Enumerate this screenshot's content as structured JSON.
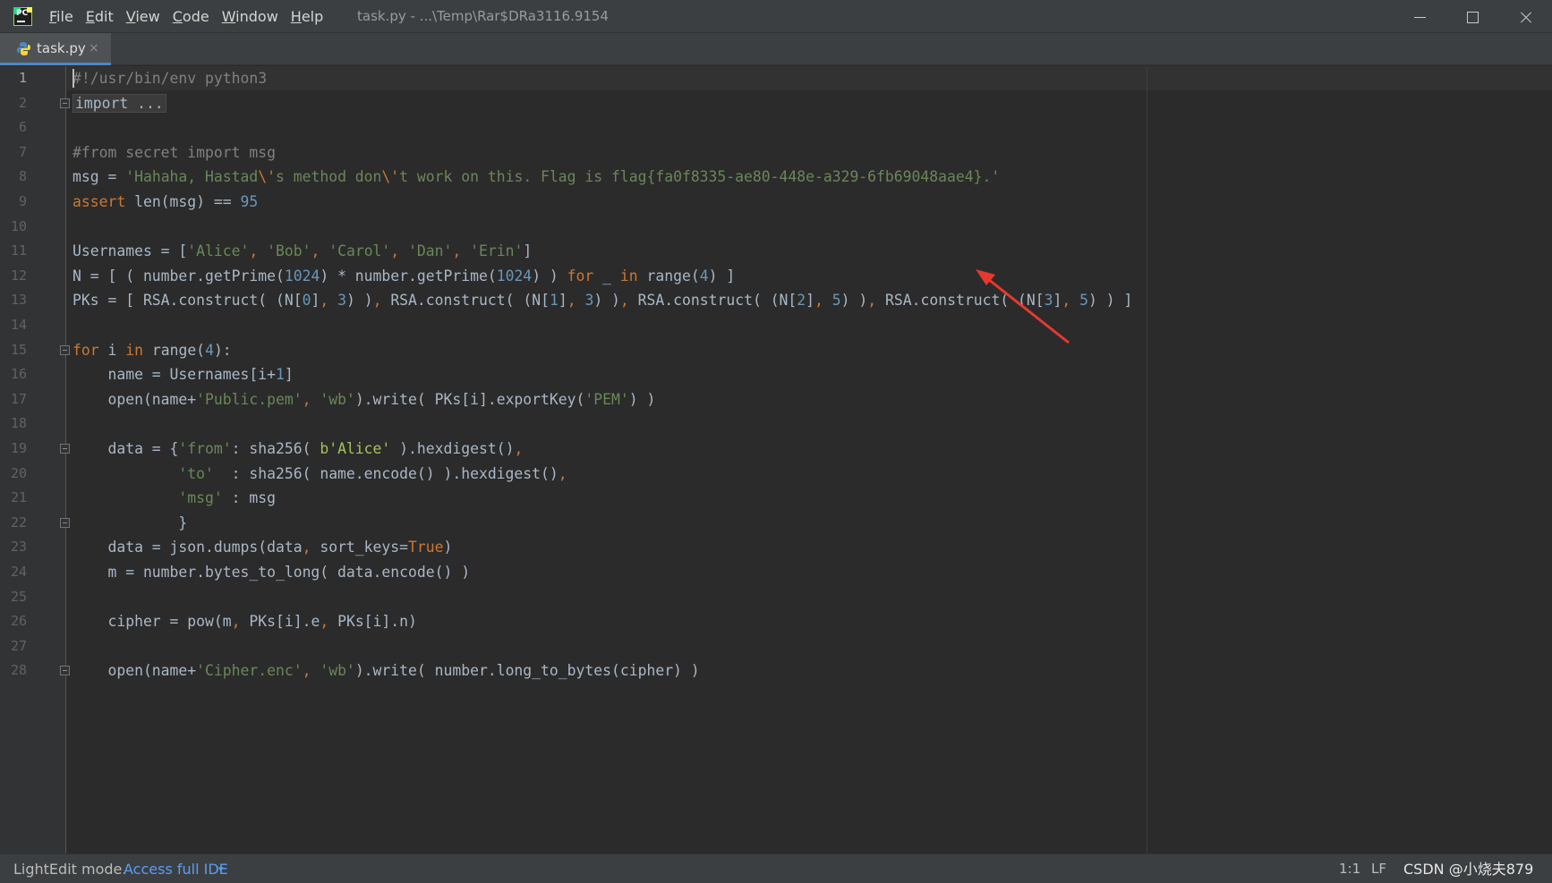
{
  "titlebar": {
    "menu": [
      {
        "label": "File",
        "mnemonic": "F",
        "rest": "ile"
      },
      {
        "label": "Edit",
        "mnemonic": "E",
        "rest": "dit"
      },
      {
        "label": "View",
        "mnemonic": "V",
        "rest": "iew"
      },
      {
        "label": "Code",
        "mnemonic": "C",
        "rest": "ode"
      },
      {
        "label": "Window",
        "mnemonic": "W",
        "rest": "indow"
      },
      {
        "label": "Help",
        "mnemonic": "H",
        "rest": "elp"
      }
    ],
    "window_title": "task.py - ...\\Temp\\Rar$DRa3116.9154",
    "logo_text": "PC",
    "controls": [
      "minimize-icon",
      "maximize-icon",
      "close-icon"
    ]
  },
  "tabs": [
    {
      "label": "task.py",
      "icon": "python-file-icon",
      "close": "×",
      "active": true
    }
  ],
  "editor": {
    "current_line": 1,
    "lines": [
      {
        "n": "1",
        "tokens": [
          [
            "com",
            "#!/usr/bin/env python3"
          ]
        ]
      },
      {
        "n": "2",
        "fold": true,
        "tokens": [
          [
            "fold",
            "import ..."
          ]
        ]
      },
      {
        "n": "6",
        "tokens": []
      },
      {
        "n": "7",
        "tokens": [
          [
            "com",
            "#from secret import msg"
          ]
        ]
      },
      {
        "n": "8",
        "tokens": [
          [
            "",
            "msg = "
          ],
          [
            "str",
            "'Hahaha, Hastad"
          ],
          [
            "esc",
            "\\'"
          ],
          [
            "str",
            "s method don"
          ],
          [
            "esc",
            "\\'"
          ],
          [
            "str",
            "t work on this. Flag is flag{fa0f8335-ae80-448e-a329-6fb69048aae4}.'"
          ]
        ]
      },
      {
        "n": "9",
        "tokens": [
          [
            "kw",
            "assert "
          ],
          [
            "",
            "len(msg) == "
          ],
          [
            "num",
            "95"
          ]
        ]
      },
      {
        "n": "10",
        "tokens": []
      },
      {
        "n": "11",
        "tokens": [
          [
            "",
            "Usernames = ["
          ],
          [
            "str",
            "'Alice'"
          ],
          [
            "kw",
            ", "
          ],
          [
            "str",
            "'Bob'"
          ],
          [
            "kw",
            ", "
          ],
          [
            "str",
            "'Carol'"
          ],
          [
            "kw",
            ", "
          ],
          [
            "str",
            "'Dan'"
          ],
          [
            "kw",
            ", "
          ],
          [
            "str",
            "'Erin'"
          ],
          [
            "",
            "]"
          ]
        ]
      },
      {
        "n": "12",
        "tokens": [
          [
            "",
            "N = [ ( number.getPrime("
          ],
          [
            "num",
            "1024"
          ],
          [
            "",
            ") * number.getPrime("
          ],
          [
            "num",
            "1024"
          ],
          [
            "",
            ") ) "
          ],
          [
            "kw",
            "for "
          ],
          [
            "",
            "_ "
          ],
          [
            "kw",
            "in "
          ],
          [
            "",
            "range("
          ],
          [
            "num",
            "4"
          ],
          [
            "",
            ") ]"
          ]
        ]
      },
      {
        "n": "13",
        "tokens": [
          [
            "",
            "PKs = [ RSA.construct( (N["
          ],
          [
            "num",
            "0"
          ],
          [
            "",
            "]"
          ],
          [
            "kw",
            ", "
          ],
          [
            "num",
            "3"
          ],
          [
            "",
            ") )"
          ],
          [
            "kw",
            ", "
          ],
          [
            "",
            "RSA.construct( (N["
          ],
          [
            "num",
            "1"
          ],
          [
            "",
            "]"
          ],
          [
            "kw",
            ", "
          ],
          [
            "num",
            "3"
          ],
          [
            "",
            ") )"
          ],
          [
            "kw",
            ", "
          ],
          [
            "",
            "RSA.construct( (N["
          ],
          [
            "num",
            "2"
          ],
          [
            "",
            "]"
          ],
          [
            "kw",
            ", "
          ],
          [
            "num",
            "5"
          ],
          [
            "",
            ") )"
          ],
          [
            "kw",
            ", "
          ],
          [
            "",
            "RSA.construct( (N["
          ],
          [
            "num",
            "3"
          ],
          [
            "",
            "]"
          ],
          [
            "kw",
            ", "
          ],
          [
            "num",
            "5"
          ],
          [
            "",
            ") ) ]"
          ]
        ]
      },
      {
        "n": "14",
        "tokens": []
      },
      {
        "n": "15",
        "fold": true,
        "tokens": [
          [
            "kw",
            "for "
          ],
          [
            "",
            "i "
          ],
          [
            "kw",
            "in "
          ],
          [
            "",
            "range("
          ],
          [
            "num",
            "4"
          ],
          [
            "",
            "):"
          ]
        ]
      },
      {
        "n": "16",
        "tokens": [
          [
            "",
            "    name = Usernames[i+"
          ],
          [
            "num",
            "1"
          ],
          [
            "",
            "]"
          ]
        ]
      },
      {
        "n": "17",
        "tokens": [
          [
            "",
            "    open(name+"
          ],
          [
            "str",
            "'Public.pem'"
          ],
          [
            "kw",
            ", "
          ],
          [
            "str",
            "'wb'"
          ],
          [
            "",
            ").write( PKs[i].exportKey("
          ],
          [
            "str",
            "'PEM'"
          ],
          [
            "",
            ") )"
          ]
        ]
      },
      {
        "n": "18",
        "tokens": []
      },
      {
        "n": "19",
        "fold": true,
        "tokens": [
          [
            "",
            "    data = {"
          ],
          [
            "str",
            "'from'"
          ],
          [
            "",
            ": sha256( "
          ],
          [
            "bytes",
            "b'Alice'"
          ],
          [
            "",
            " ).hexdigest()"
          ],
          [
            "kw",
            ","
          ]
        ]
      },
      {
        "n": "20",
        "tokens": [
          [
            "",
            "            "
          ],
          [
            "str",
            "'to'"
          ],
          [
            "",
            "  : sha256( name.encode() ).hexdigest()"
          ],
          [
            "kw",
            ","
          ]
        ]
      },
      {
        "n": "21",
        "tokens": [
          [
            "",
            "            "
          ],
          [
            "str",
            "'msg'"
          ],
          [
            "",
            " : msg"
          ]
        ]
      },
      {
        "n": "22",
        "fold": true,
        "tokens": [
          [
            "",
            "            }"
          ]
        ]
      },
      {
        "n": "23",
        "tokens": [
          [
            "",
            "    data = json.dumps(data"
          ],
          [
            "kw",
            ", "
          ],
          [
            "",
            "sort_keys="
          ],
          [
            "kw",
            "True"
          ],
          [
            "",
            ")"
          ]
        ]
      },
      {
        "n": "24",
        "tokens": [
          [
            "",
            "    m = number.bytes_to_long( data.encode() )"
          ]
        ]
      },
      {
        "n": "25",
        "tokens": []
      },
      {
        "n": "26",
        "tokens": [
          [
            "",
            "    cipher = pow(m"
          ],
          [
            "kw",
            ", "
          ],
          [
            "",
            "PKs[i].e"
          ],
          [
            "kw",
            ", "
          ],
          [
            "",
            "PKs[i].n)"
          ]
        ]
      },
      {
        "n": "27",
        "tokens": []
      },
      {
        "n": "28",
        "fold": true,
        "tokens": [
          [
            "",
            "    open(name+"
          ],
          [
            "str",
            "'Cipher.enc'"
          ],
          [
            "kw",
            ", "
          ],
          [
            "str",
            "'wb'"
          ],
          [
            "",
            ").write( number.long_to_bytes(cipher) )"
          ]
        ]
      }
    ]
  },
  "annotation": {
    "icon": "red-arrow-icon",
    "color": "#e8382d"
  },
  "statusbar": {
    "mode": "LightEdit mode.",
    "link": "Access full IDE",
    "link_icon": "chevron-down-icon",
    "position": "1:1",
    "line_ending": "LF",
    "watermark": "CSDN @小烧夫879"
  },
  "colors": {
    "background": "#2b2b2b",
    "keyword": "#cc7832",
    "string": "#6a8759",
    "number": "#6897bb",
    "comment": "#808080",
    "link": "#589df6"
  }
}
